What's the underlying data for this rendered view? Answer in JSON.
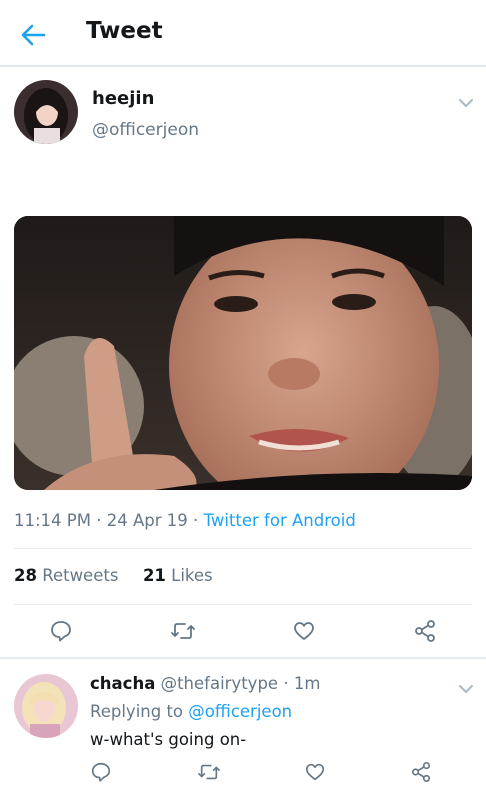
{
  "header": {
    "title": "Tweet"
  },
  "tweet": {
    "display_name": "heejin",
    "handle": "@officerjeon",
    "time": "11:14 PM",
    "date": "24 Apr 19",
    "source": "Twitter for Android",
    "retweets_count": "28",
    "retweets_label": "Retweets",
    "likes_count": "21",
    "likes_label": "Likes"
  },
  "reply": {
    "display_name": "chacha",
    "handle": "@thefairytype",
    "age": "1m",
    "replying_prefix": "Replying to",
    "replying_to": "@officerjeon",
    "text": "w-what's going on-"
  },
  "colors": {
    "accent": "#1da1f2",
    "secondary_text": "#657786",
    "divider": "#e6ecf0"
  }
}
